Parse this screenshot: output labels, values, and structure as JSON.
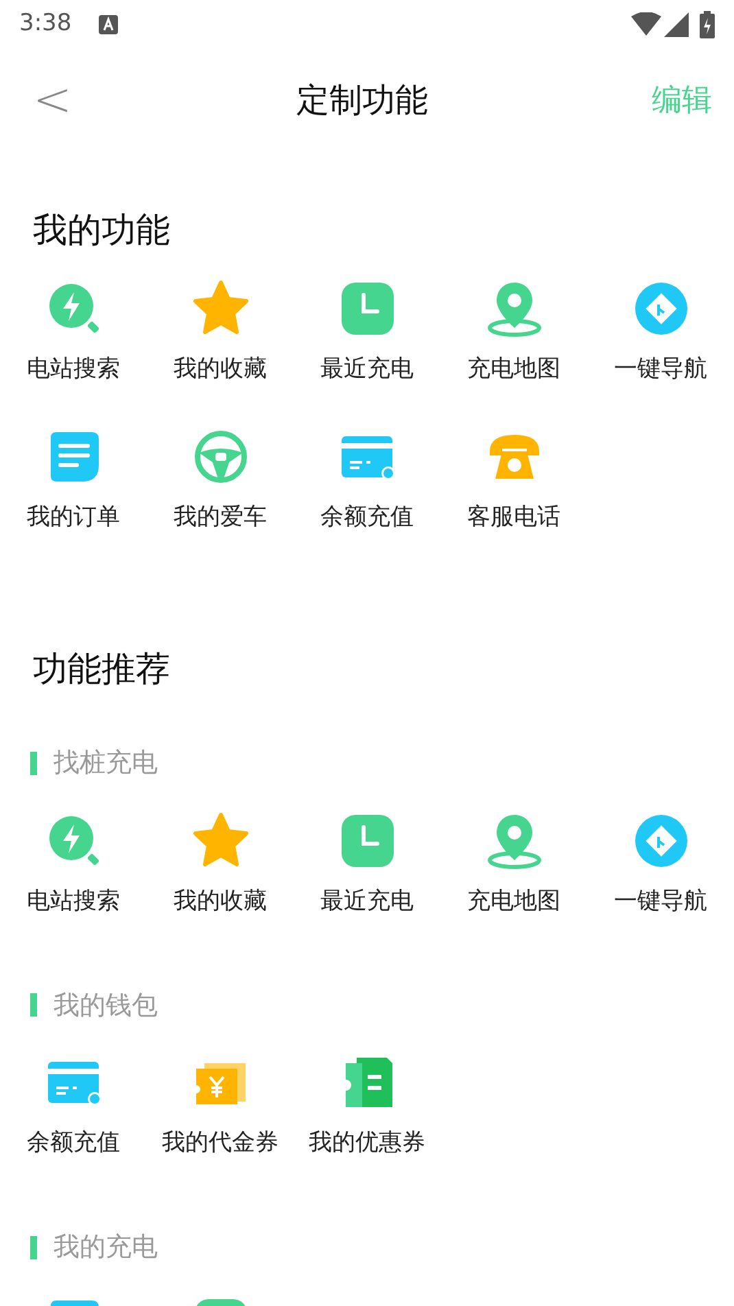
{
  "status_bar": {
    "time": "3:38"
  },
  "nav": {
    "back": "<",
    "title": "定制功能",
    "action": "编辑"
  },
  "my_functions": {
    "title": "我的功能",
    "items": [
      {
        "kind": "search",
        "label": "电站搜索"
      },
      {
        "kind": "star",
        "label": "我的收藏"
      },
      {
        "kind": "clock",
        "label": "最近充电"
      },
      {
        "kind": "map",
        "label": "充电地图"
      },
      {
        "kind": "navigate",
        "label": "一键导航"
      },
      {
        "kind": "order",
        "label": "我的订单"
      },
      {
        "kind": "wheel",
        "label": "我的爱车"
      },
      {
        "kind": "card",
        "label": "余额充值"
      },
      {
        "kind": "phone",
        "label": "客服电话"
      }
    ]
  },
  "recommended": {
    "title": "功能推荐",
    "groups": [
      {
        "title": "找桩充电",
        "items": [
          {
            "kind": "search",
            "label": "电站搜索"
          },
          {
            "kind": "star",
            "label": "我的收藏"
          },
          {
            "kind": "clock",
            "label": "最近充电"
          },
          {
            "kind": "map",
            "label": "充电地图"
          },
          {
            "kind": "navigate",
            "label": "一键导航"
          }
        ]
      },
      {
        "title": "我的钱包",
        "items": [
          {
            "kind": "card",
            "label": "余额充值"
          },
          {
            "kind": "voucher",
            "label": "我的代金券"
          },
          {
            "kind": "coupon",
            "label": "我的优惠券"
          }
        ]
      },
      {
        "title": "我的充电",
        "items": [
          {
            "kind": "order"
          },
          {
            "kind": "clock"
          }
        ]
      }
    ]
  }
}
